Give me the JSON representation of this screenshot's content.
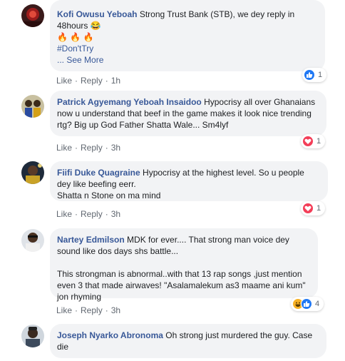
{
  "colors": {
    "author": "#385898",
    "bubble": "#f2f3f5",
    "meta": "#606770",
    "like": "#2078f4",
    "love": "#f33e58",
    "haha": "#f7b125"
  },
  "comments": [
    {
      "author": "Kofi Owusu Yeboah",
      "lines": [
        "Strong Trust Bank (STB), we dey reply in 48hours 😂"
      ],
      "emoji_line": "🔥 🔥 🔥",
      "hashtag": "#Don'tTry",
      "see_more": "... See More",
      "like": "Like",
      "reply": "Reply",
      "time": "1h",
      "reaction_icons": [
        "like-icon"
      ],
      "reaction_count": "1"
    },
    {
      "author": "Patrick Agyemang Yeboah Insaidoo",
      "lines": [
        "Hypocrisy all over Ghanaians now u understand that beef in the game makes it look nice trending rtg? Big up God Father Shatta Wale... Sm4lyf"
      ],
      "like": "Like",
      "reply": "Reply",
      "time": "3h",
      "reaction_icons": [
        "love-icon"
      ],
      "reaction_count": "1"
    },
    {
      "author": "Fiifi Duke Quagraine",
      "lines": [
        "Hypocrisy at the highest level. So u people dey like beefing eerr.",
        "Shatta n Stone on ma mind"
      ],
      "like": "Like",
      "reply": "Reply",
      "time": "3h",
      "reaction_icons": [
        "love-icon"
      ],
      "reaction_count": "1"
    },
    {
      "author": "Nartey Edmilson",
      "lines": [
        "MDK for ever.... That strong man voice dey sound like dos days shs battle...",
        "This strongman is abnormal..with that 13 rap songs ,just mention even 3 that made airwaves! \"Asalamalekum as3 maame ani kum\" jon rhyming"
      ],
      "like": "Like",
      "reply": "Reply",
      "time": "3h",
      "reaction_icons": [
        "haha-icon",
        "like-icon"
      ],
      "reaction_count": "4"
    },
    {
      "author": "Joseph Nyarko Abronoma",
      "lines": [
        "Oh strong just murdered the guy. Case die"
      ]
    }
  ]
}
